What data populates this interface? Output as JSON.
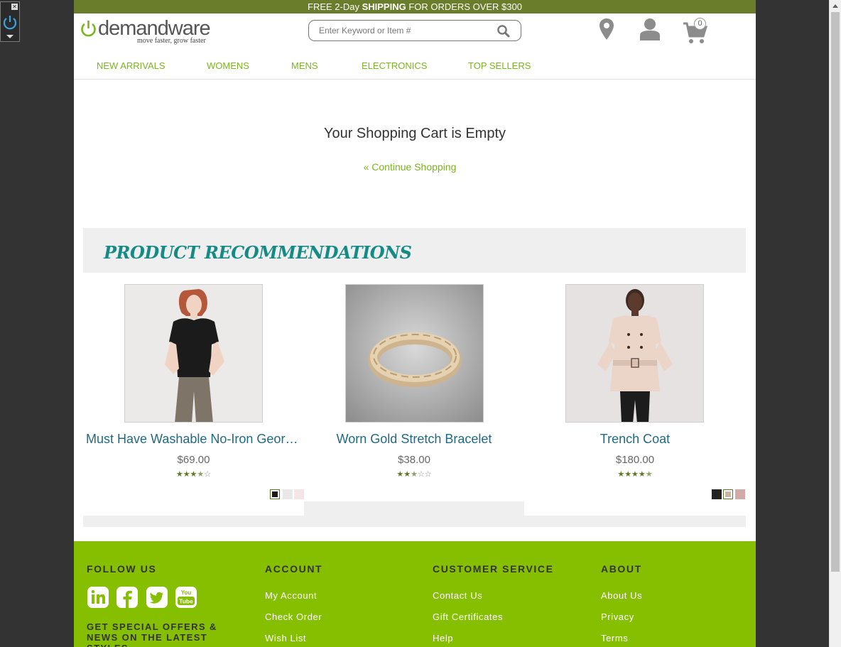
{
  "promo": {
    "pre": "FREE 2-Day ",
    "bold": "SHIPPING",
    "post": " FOR ORDERS OVER $300"
  },
  "logo": {
    "name": "demandware",
    "tagline": "move faster, grow faster"
  },
  "search": {
    "placeholder": "Enter Keyword or Item #"
  },
  "header": {
    "cart_count": "0"
  },
  "nav": [
    "NEW ARRIVALS",
    "WOMENS",
    "MENS",
    "ELECTRONICS",
    "TOP SELLERS"
  ],
  "cart": {
    "title": "Your Shopping Cart is Empty",
    "continue_label": "« Continue Shopping"
  },
  "recommendations": {
    "title": "PRODUCT RECOMMENDATIONS",
    "products": [
      {
        "name": "Must Have Washable No-Iron Georg...",
        "price": "$69.00",
        "rating": 3.5,
        "stars": "★★★★☆",
        "swatches": [
          "#1a1a1a",
          "#e8e8e8",
          "#f6e4e6"
        ]
      },
      {
        "name": "Worn Gold Stretch Bracelet",
        "price": "$38.00",
        "rating": 2.5,
        "stars": "★★★☆☆",
        "swatches": []
      },
      {
        "name": "Trench Coat",
        "price": "$180.00",
        "rating": 4.5,
        "stars": "★★★★★",
        "swatches": [
          "#222222",
          "#c9b6a4",
          "#d4aaa6"
        ]
      }
    ]
  },
  "footer": {
    "follow_title": "FOLLOW US",
    "social": [
      "linkedin-icon",
      "facebook-icon",
      "twitter-icon",
      "youtube-icon"
    ],
    "offers_text": "GET SPECIAL OFFERS & NEWS ON THE LATEST STYLES",
    "account": {
      "title": "ACCOUNT",
      "links": [
        "My Account",
        "Check Order",
        "Wish List"
      ]
    },
    "customer_service": {
      "title": "CUSTOMER SERVICE",
      "links": [
        "Contact Us",
        "Gift Certificates",
        "Help"
      ]
    },
    "about": {
      "title": "ABOUT",
      "links": [
        "About Us",
        "Privacy",
        "Terms"
      ]
    }
  },
  "colors": {
    "accent": "#86bf00",
    "promo_bar": "#6a7d2a",
    "nav_green": "#7ab51d",
    "recs_title": "#168b86"
  }
}
